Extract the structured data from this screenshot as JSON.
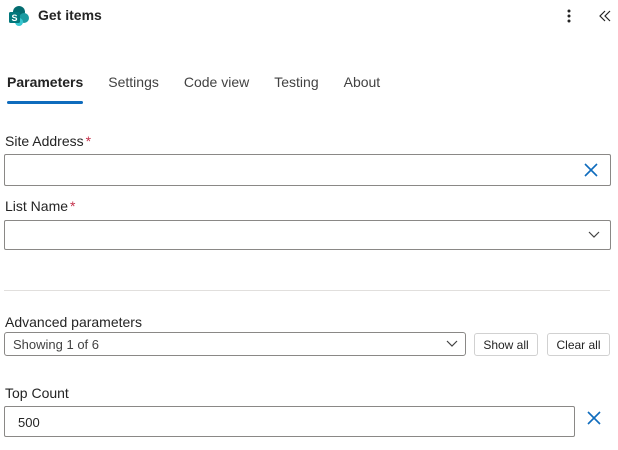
{
  "header": {
    "title": "Get items",
    "app_icon": "sharepoint-icon",
    "more_icon": "more-vertical-icon",
    "collapse_icon": "double-chevron-left-icon"
  },
  "tabs": [
    {
      "label": "Parameters",
      "active": true
    },
    {
      "label": "Settings",
      "active": false
    },
    {
      "label": "Code view",
      "active": false
    },
    {
      "label": "Testing",
      "active": false
    },
    {
      "label": "About",
      "active": false
    }
  ],
  "fields": {
    "site_address": {
      "label": "Site Address",
      "required_mark": "*",
      "value": ""
    },
    "list_name": {
      "label": "List Name",
      "required_mark": "*",
      "value": ""
    },
    "advanced": {
      "label": "Advanced parameters",
      "selected": "Showing 1 of 6",
      "show_all": "Show all",
      "clear_all": "Clear all"
    },
    "top_count": {
      "label": "Top Count",
      "value": "500"
    }
  },
  "colors": {
    "accent": "#0f6cbd",
    "required": "#c4314b",
    "sharepoint_teal": "#038387"
  }
}
